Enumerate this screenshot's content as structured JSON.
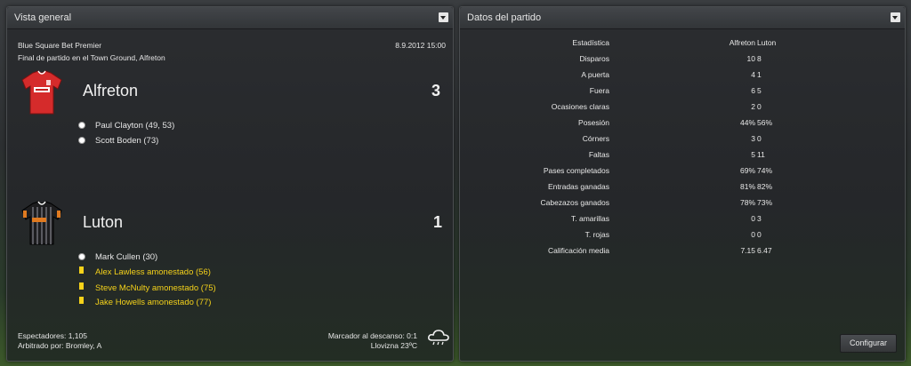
{
  "overview": {
    "title": "Vista general",
    "competition": "Blue Square Bet Premier",
    "date": "8.9.2012 15:00",
    "venue": "Final de partido en el Town Ground, Alfreton",
    "home": {
      "name": "Alfreton",
      "score": "3",
      "events": [
        {
          "type": "goal",
          "text": "Paul Clayton (49, 53)"
        },
        {
          "type": "goal",
          "text": "Scott Boden (73)"
        }
      ]
    },
    "away": {
      "name": "Luton",
      "score": "1",
      "events": [
        {
          "type": "goal",
          "text": "Mark Cullen (30)"
        },
        {
          "type": "yellow",
          "text": "Alex Lawless amonestado (56)"
        },
        {
          "type": "yellow",
          "text": "Steve McNulty amonestado (75)"
        },
        {
          "type": "yellow",
          "text": "Jake Howells amonestado (77)"
        }
      ]
    },
    "attendance": "Espectadores: 1,105",
    "referee": "Arbitrado por: Bromley, A",
    "halftime": "Marcador al descanso: 0:1",
    "weather": "Llovizna 23ºC",
    "weather_icon": "rain-cloud-icon"
  },
  "stats": {
    "title": "Datos del partido",
    "header": {
      "label": "Estadística",
      "home": "Alfreton",
      "away": "Luton"
    },
    "rows": [
      {
        "label": "Disparos",
        "home": "10",
        "away": "8"
      },
      {
        "label": "A puerta",
        "home": "4",
        "away": "1"
      },
      {
        "label": "Fuera",
        "home": "6",
        "away": "5"
      },
      {
        "label": "Ocasiones claras",
        "home": "2",
        "away": "0"
      },
      {
        "label": "Posesión",
        "home": "44%",
        "away": "56%"
      },
      {
        "label": "Córners",
        "home": "3",
        "away": "0"
      },
      {
        "label": "Faltas",
        "home": "5",
        "away": "11"
      },
      {
        "label": "Pases completados",
        "home": "69%",
        "away": "74%"
      },
      {
        "label": "Entradas ganadas",
        "home": "81%",
        "away": "82%"
      },
      {
        "label": "Cabezazos ganados",
        "home": "78%",
        "away": "73%"
      },
      {
        "label": "T. amarillas",
        "home": "0",
        "away": "3"
      },
      {
        "label": "T. rojas",
        "home": "0",
        "away": "0"
      },
      {
        "label": "Calificación media",
        "home": "7.15",
        "away": "6.47"
      }
    ],
    "configure_label": "Configurar"
  }
}
